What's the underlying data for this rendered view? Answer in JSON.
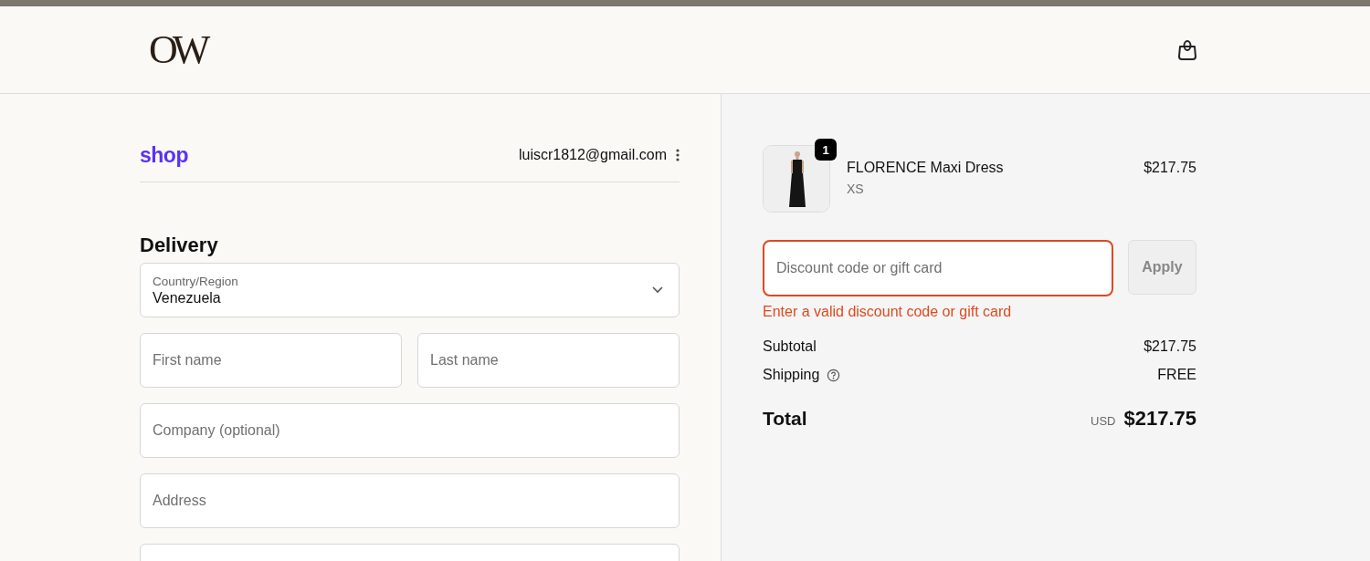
{
  "header": {
    "logo": "OW"
  },
  "account": {
    "brand": "shop",
    "email": "luiscr1812@gmail.com"
  },
  "delivery": {
    "title": "Delivery",
    "fields": [
      {
        "kind": "select",
        "label": "Country/Region",
        "value": "Venezuela"
      },
      {
        "kind": "pair",
        "items": [
          {
            "placeholder": "First name"
          },
          {
            "placeholder": "Last name"
          }
        ]
      },
      {
        "kind": "text",
        "placeholder": "Company (optional)"
      },
      {
        "kind": "text",
        "placeholder": "Address"
      },
      {
        "kind": "text"
      }
    ]
  },
  "cart": {
    "items": [
      {
        "name": "FLORENCE Maxi Dress",
        "variant": "XS",
        "price": "$217.75",
        "quantity": "1",
        "kind": "picture"
      }
    ]
  },
  "discount": {
    "placeholder": "Discount code or gift card",
    "button": "Apply",
    "error": "Enter a valid discount code or gift card"
  },
  "summary": [
    {
      "label": "Subtotal",
      "value": "$217.75",
      "help": false
    },
    {
      "label": "Shipping",
      "value": "FREE",
      "help": true
    }
  ],
  "total": {
    "label": "Total",
    "currency": "USD",
    "value": "$217.75"
  }
}
